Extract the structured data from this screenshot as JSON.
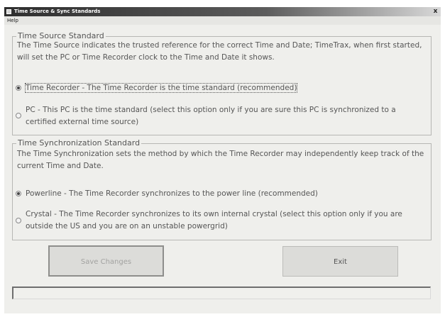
{
  "window": {
    "title": "Time Source & Sync Standards",
    "close_glyph": "x"
  },
  "menu": {
    "help_label": "Help"
  },
  "time_source": {
    "legend": "Time Source Standard",
    "description": "The Time Source indicates the trusted reference for the correct Time and Date; TimeTrax, when first started, will set the PC or Time Recorder clock to the Time and Date it shows.",
    "options": [
      {
        "label": "Time Recorder - The Time Recorder is the time standard (recommended)",
        "selected": true
      },
      {
        "label": "PC - This PC is the time standard (select this option only if you are sure this PC is synchronized to a certified external time source)",
        "selected": false
      }
    ]
  },
  "time_sync": {
    "legend": "Time Synchronization Standard",
    "description": "The Time Synchronization sets the method by which the Time Recorder may independently keep track of the current Time and Date.",
    "options": [
      {
        "label": "Powerline - The Time Recorder synchronizes to the power line (recommended)",
        "selected": true
      },
      {
        "label": "Crystal - The Time Recorder synchronizes to its own internal crystal (select this option only if you are outside the US and you are on an unstable powergrid)",
        "selected": false
      }
    ]
  },
  "buttons": {
    "save_label": "Save Changes",
    "save_enabled": false,
    "exit_label": "Exit"
  },
  "status_text": ""
}
